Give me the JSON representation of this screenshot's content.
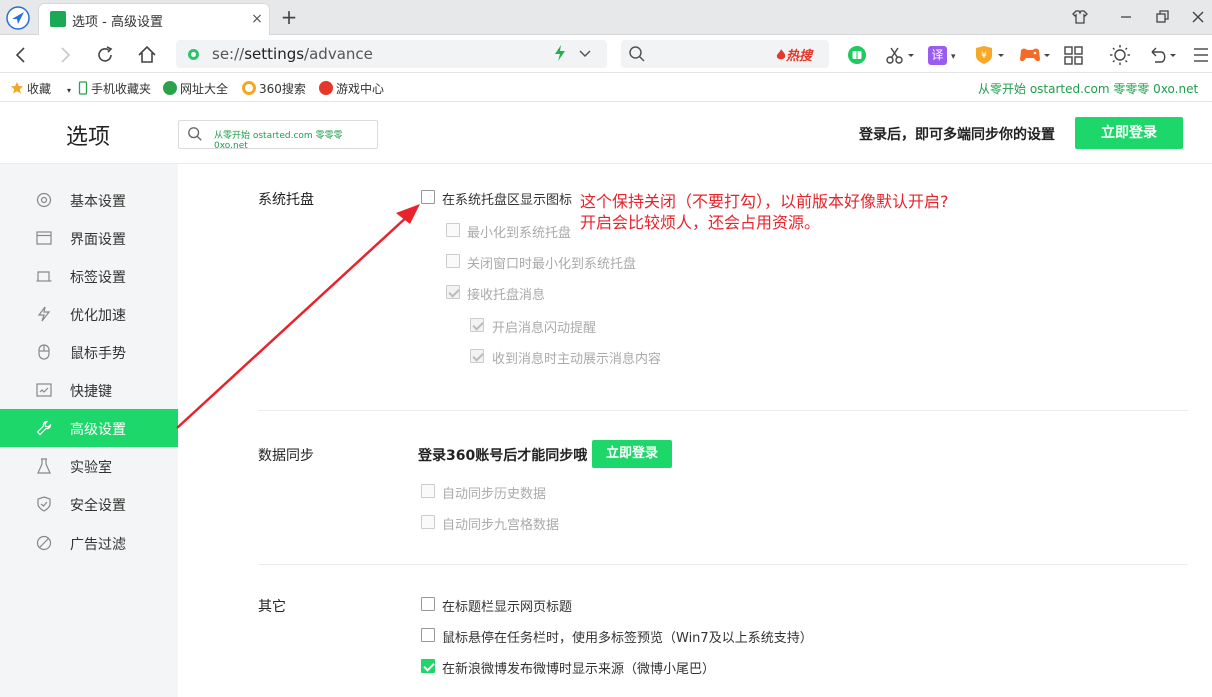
{
  "browser": {
    "tab_title": "选项 - 高级设置",
    "tab_close": "×",
    "new_tab": "+",
    "url_scheme": "se://",
    "url_host": "settings",
    "url_path": "/advance",
    "hot_search": "热搜",
    "translate_label": "译",
    "bookmarks": {
      "favorites": "收藏",
      "mobile": "手机收藏夹",
      "sites": "网址大全",
      "search360": "360搜索",
      "games": "游戏中心"
    },
    "bookmark_right": "从零开始 ostarted.com 零零零 0xo.net"
  },
  "header": {
    "title": "选项",
    "search_value": "从零开始 ostarted.com 零零零 0xo.net",
    "sync_hint": "登录后，即可多端同步你的设置",
    "login_button": "立即登录"
  },
  "sidebar": {
    "items": [
      {
        "label": "基本设置",
        "icon": "gear-icon"
      },
      {
        "label": "界面设置",
        "icon": "window-icon"
      },
      {
        "label": "标签设置",
        "icon": "tab-icon"
      },
      {
        "label": "优化加速",
        "icon": "lightning-icon"
      },
      {
        "label": "鼠标手势",
        "icon": "mouse-icon"
      },
      {
        "label": "快捷键",
        "icon": "keyboard-icon"
      },
      {
        "label": "高级设置",
        "icon": "wrench-icon",
        "active": true
      },
      {
        "label": "实验室",
        "icon": "flask-icon"
      },
      {
        "label": "安全设置",
        "icon": "shield-icon"
      },
      {
        "label": "广告过滤",
        "icon": "block-icon"
      }
    ]
  },
  "tray": {
    "label": "系统托盘",
    "options": [
      {
        "label": "在系统托盘区显示图标",
        "checked": false,
        "disabled": false
      },
      {
        "label": "最小化到系统托盘",
        "checked": false,
        "disabled": true
      },
      {
        "label": "关闭窗口时最小化到系统托盘",
        "checked": false,
        "disabled": true
      },
      {
        "label": "接收托盘消息",
        "checked": true,
        "disabled": true
      },
      {
        "label": "开启消息闪动提醒",
        "checked": true,
        "disabled": true
      },
      {
        "label": "收到消息时主动展示消息内容",
        "checked": true,
        "disabled": true
      }
    ]
  },
  "sync": {
    "label": "数据同步",
    "hint": "登录360账号后才能同步哦",
    "login_button": "立即登录",
    "options": [
      {
        "label": "自动同步历史数据",
        "checked": false,
        "disabled": true
      },
      {
        "label": "自动同步九宫格数据",
        "checked": false,
        "disabled": true
      }
    ]
  },
  "other": {
    "label": "其它",
    "options": [
      {
        "label": "在标题栏显示网页标题",
        "checked": false,
        "disabled": false
      },
      {
        "label": "鼠标悬停在任务栏时，使用多标签预览（Win7及以上系统支持）",
        "checked": false,
        "disabled": false
      },
      {
        "label": "在新浪微博发布微博时显示来源（微博小尾巴）",
        "checked": true,
        "disabled": false
      }
    ]
  },
  "annotation": {
    "line1": "这个保持关闭（不要打勾），以前版本好像默认开启?",
    "line2": "开启会比较烦人，还会占用资源。"
  },
  "colors": {
    "accent": "#1ed76a",
    "annotation": "#e8232b",
    "link_green": "#1e9e4a"
  }
}
